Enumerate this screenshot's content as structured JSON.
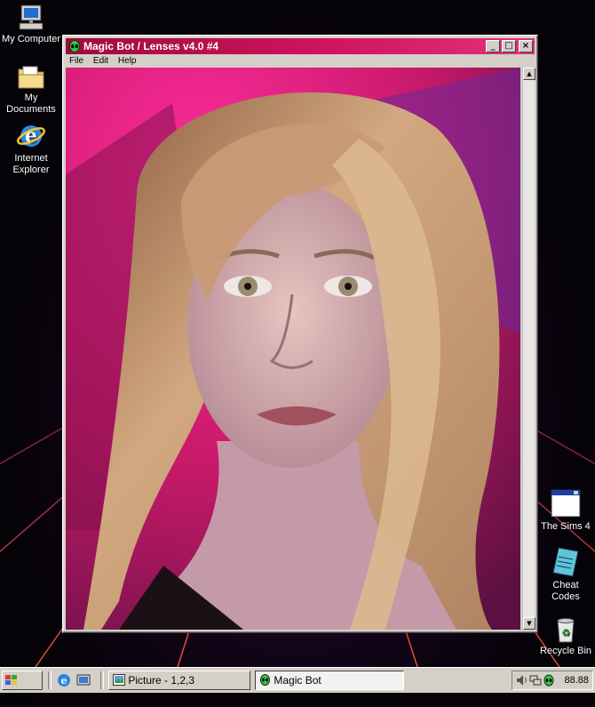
{
  "desktop": {
    "icons_left": [
      {
        "label": "My Computer",
        "icon": "computer-icon"
      },
      {
        "label": "My Documents",
        "icon": "folder-icon"
      },
      {
        "label": "Internet Explorer",
        "icon": "internet-explorer-icon"
      }
    ],
    "icons_right": [
      {
        "label": "The Sims 4",
        "icon": "window-icon"
      },
      {
        "label": "Cheat Codes",
        "icon": "notepad-icon"
      },
      {
        "label": "Recycle Bin",
        "icon": "recycle-bin-icon"
      }
    ]
  },
  "window": {
    "title": "Magic Bot / Lenses v4.0 #4",
    "title_icon": "alien-head-icon",
    "menu": [
      "File",
      "Edit",
      "Help"
    ],
    "controls": {
      "minimize": "_",
      "maximize": "□",
      "close": "×"
    },
    "content": "portrait of a young woman with long blonde hair on a pink-magenta background"
  },
  "taskbar": {
    "start_label": "Start",
    "quick_launch": [
      "internet-explorer-icon",
      "desktop-icon"
    ],
    "tasks": [
      {
        "label": "Picture - 1,2,3",
        "icon": "picture-icon",
        "active": false
      },
      {
        "label": "Magic Bot",
        "icon": "alien-head-icon",
        "active": true
      }
    ],
    "tray_icons": [
      "volume-icon",
      "network-icon",
      "alien-head-icon"
    ],
    "clock": "88.88"
  },
  "colors": {
    "title_bar": "#c01258",
    "chrome": "#d4d0c8",
    "background_accent": "#ff3b9a"
  }
}
